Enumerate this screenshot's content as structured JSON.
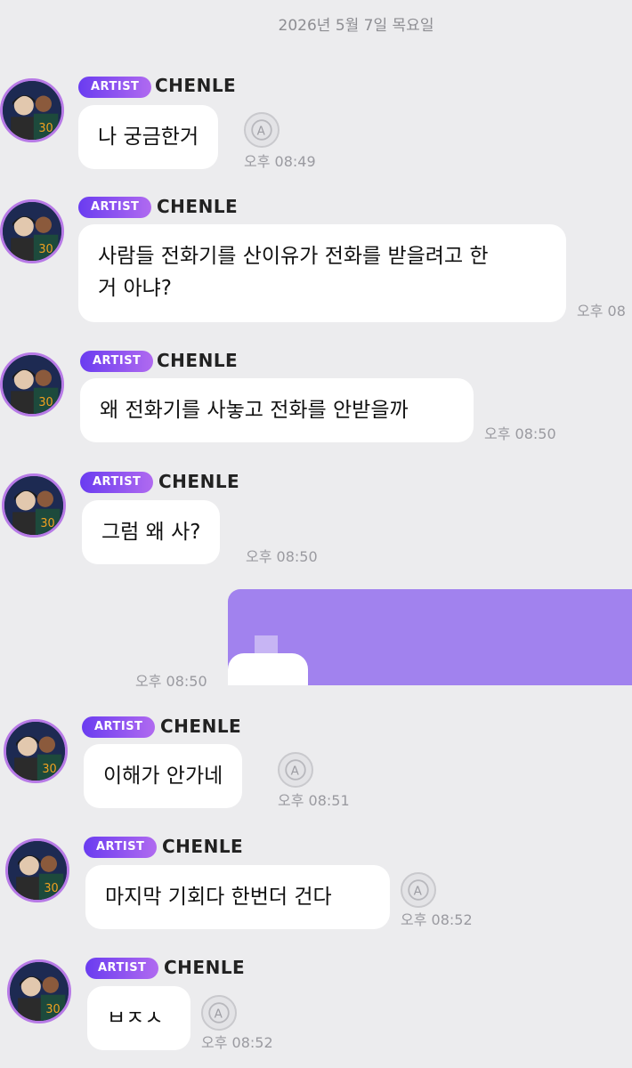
{
  "date_divider": "2026년 5월 7일 목요일",
  "badge_label": "ARTIST",
  "sender_name": "CHENLE",
  "messages": [
    {
      "text": "나 궁금한거",
      "time": "오후 08:49"
    },
    {
      "text_line1": "사람들 전화기를 산이유가 전화를 받을려고 한",
      "text_line2": "거 아냐?",
      "time": "오후 08"
    },
    {
      "text": "왜 전화기를 사놓고 전화를 안받을까",
      "time": "오후 08:50"
    },
    {
      "text": "그럼 왜 사?",
      "time": "오후 08:50"
    },
    {
      "text": "이해가 안가네",
      "time": "오후 08:51"
    },
    {
      "text": "마지막 기회다 한번더 건다",
      "time": "오후 08:52"
    },
    {
      "text": "ㅂㅈㅅ",
      "time": "오후 08:52"
    }
  ],
  "my_message": {
    "time": "오후 08:50"
  },
  "colors": {
    "background": "#ececee",
    "bubble": "#ffffff",
    "my_bubble": "#a182ee",
    "badge_from": "#6a3cf0",
    "badge_to": "#b06af0",
    "avatar_ring": "#b77ae6"
  },
  "icons": {
    "translate": "translate-icon",
    "avatar": "artist-avatar"
  }
}
